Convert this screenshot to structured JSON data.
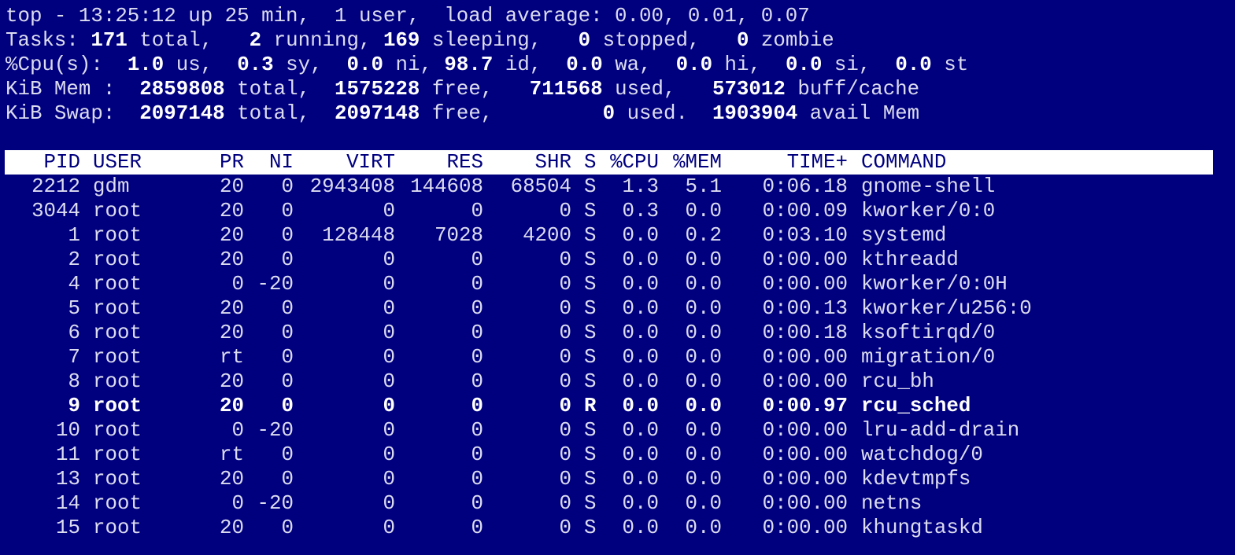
{
  "summary": {
    "line1": "top - 13:25:12 up 25 min,  1 user,  load average: 0.00, 0.01, 0.07",
    "tasks": {
      "label": "Tasks:",
      "total": "171",
      "total_label": " total,",
      "running": "2",
      "running_label": " running,",
      "sleeping": "169",
      "sleeping_label": " sleeping,",
      "stopped": "0",
      "stopped_label": " stopped,",
      "zombie": "0",
      "zombie_label": " zombie"
    },
    "cpu": {
      "label": "%Cpu(s):",
      "us": "1.0",
      "us_label": " us,",
      "sy": "0.3",
      "sy_label": " sy,",
      "ni": "0.0",
      "ni_label": " ni,",
      "id": "98.7",
      "id_label": " id,",
      "wa": "0.0",
      "wa_label": " wa,",
      "hi": "0.0",
      "hi_label": " hi,",
      "si": "0.0",
      "si_label": " si,",
      "st": "0.0",
      "st_label": " st"
    },
    "mem": {
      "label": "KiB Mem :",
      "total": "2859808",
      "total_label": " total,",
      "free": "1575228",
      "free_label": " free,",
      "used": "711568",
      "used_label": " used,",
      "buff": "573012",
      "buff_label": " buff/cache"
    },
    "swap": {
      "label": "KiB Swap:",
      "total": "2097148",
      "total_label": " total,",
      "free": "2097148",
      "free_label": " free,",
      "used": "0",
      "used_label": " used.",
      "avail": "1903904",
      "avail_label": " avail Mem"
    }
  },
  "columns": {
    "pid": "PID",
    "user": "USER",
    "pr": "PR",
    "ni": "NI",
    "virt": "VIRT",
    "res": "RES",
    "shr": "SHR",
    "s": "S",
    "cpu": "%CPU",
    "mem": "%MEM",
    "time": "TIME+",
    "command": "COMMAND"
  },
  "processes": [
    {
      "pid": "2212",
      "user": "gdm",
      "pr": "20",
      "ni": "0",
      "virt": "2943408",
      "res": "144608",
      "shr": "68504",
      "s": "S",
      "cpu": "1.3",
      "mem": "5.1",
      "time": "0:06.18",
      "command": "gnome-shell"
    },
    {
      "pid": "3044",
      "user": "root",
      "pr": "20",
      "ni": "0",
      "virt": "0",
      "res": "0",
      "shr": "0",
      "s": "S",
      "cpu": "0.3",
      "mem": "0.0",
      "time": "0:00.09",
      "command": "kworker/0:0"
    },
    {
      "pid": "1",
      "user": "root",
      "pr": "20",
      "ni": "0",
      "virt": "128448",
      "res": "7028",
      "shr": "4200",
      "s": "S",
      "cpu": "0.0",
      "mem": "0.2",
      "time": "0:03.10",
      "command": "systemd"
    },
    {
      "pid": "2",
      "user": "root",
      "pr": "20",
      "ni": "0",
      "virt": "0",
      "res": "0",
      "shr": "0",
      "s": "S",
      "cpu": "0.0",
      "mem": "0.0",
      "time": "0:00.00",
      "command": "kthreadd"
    },
    {
      "pid": "4",
      "user": "root",
      "pr": "0",
      "ni": "-20",
      "virt": "0",
      "res": "0",
      "shr": "0",
      "s": "S",
      "cpu": "0.0",
      "mem": "0.0",
      "time": "0:00.00",
      "command": "kworker/0:0H"
    },
    {
      "pid": "5",
      "user": "root",
      "pr": "20",
      "ni": "0",
      "virt": "0",
      "res": "0",
      "shr": "0",
      "s": "S",
      "cpu": "0.0",
      "mem": "0.0",
      "time": "0:00.13",
      "command": "kworker/u256:0"
    },
    {
      "pid": "6",
      "user": "root",
      "pr": "20",
      "ni": "0",
      "virt": "0",
      "res": "0",
      "shr": "0",
      "s": "S",
      "cpu": "0.0",
      "mem": "0.0",
      "time": "0:00.18",
      "command": "ksoftirqd/0"
    },
    {
      "pid": "7",
      "user": "root",
      "pr": "rt",
      "ni": "0",
      "virt": "0",
      "res": "0",
      "shr": "0",
      "s": "S",
      "cpu": "0.0",
      "mem": "0.0",
      "time": "0:00.00",
      "command": "migration/0"
    },
    {
      "pid": "8",
      "user": "root",
      "pr": "20",
      "ni": "0",
      "virt": "0",
      "res": "0",
      "shr": "0",
      "s": "S",
      "cpu": "0.0",
      "mem": "0.0",
      "time": "0:00.00",
      "command": "rcu_bh"
    },
    {
      "pid": "9",
      "user": "root",
      "pr": "20",
      "ni": "0",
      "virt": "0",
      "res": "0",
      "shr": "0",
      "s": "R",
      "cpu": "0.0",
      "mem": "0.0",
      "time": "0:00.97",
      "command": "rcu_sched",
      "bold": true
    },
    {
      "pid": "10",
      "user": "root",
      "pr": "0",
      "ni": "-20",
      "virt": "0",
      "res": "0",
      "shr": "0",
      "s": "S",
      "cpu": "0.0",
      "mem": "0.0",
      "time": "0:00.00",
      "command": "lru-add-drain"
    },
    {
      "pid": "11",
      "user": "root",
      "pr": "rt",
      "ni": "0",
      "virt": "0",
      "res": "0",
      "shr": "0",
      "s": "S",
      "cpu": "0.0",
      "mem": "0.0",
      "time": "0:00.00",
      "command": "watchdog/0"
    },
    {
      "pid": "13",
      "user": "root",
      "pr": "20",
      "ni": "0",
      "virt": "0",
      "res": "0",
      "shr": "0",
      "s": "S",
      "cpu": "0.0",
      "mem": "0.0",
      "time": "0:00.00",
      "command": "kdevtmpfs"
    },
    {
      "pid": "14",
      "user": "root",
      "pr": "0",
      "ni": "-20",
      "virt": "0",
      "res": "0",
      "shr": "0",
      "s": "S",
      "cpu": "0.0",
      "mem": "0.0",
      "time": "0:00.00",
      "command": "netns"
    },
    {
      "pid": "15",
      "user": "root",
      "pr": "20",
      "ni": "0",
      "virt": "0",
      "res": "0",
      "shr": "0",
      "s": "S",
      "cpu": "0.0",
      "mem": "0.0",
      "time": "0:00.00",
      "command": "khungtaskd"
    }
  ],
  "colors": {
    "background": "#00007f",
    "text": "#dcdcf0",
    "highlight_text": "#ffffff",
    "header_bar": "#ffffff"
  }
}
